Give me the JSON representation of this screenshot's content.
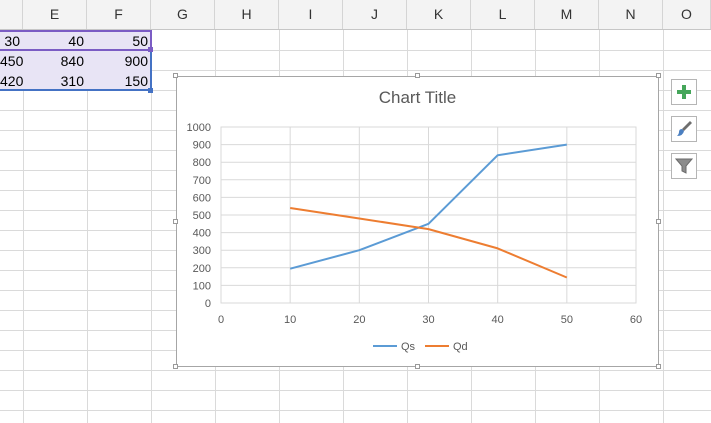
{
  "columns": [
    "E",
    "F",
    "G",
    "H",
    "I",
    "J",
    "K",
    "L",
    "M",
    "N",
    "O"
  ],
  "rows": [
    [
      "30",
      "40",
      "50"
    ],
    [
      "450",
      "840",
      "900"
    ],
    [
      "420",
      "310",
      "150"
    ]
  ],
  "colors": {
    "qs": "#5b9bd5",
    "qd": "#ed7d31",
    "selection_fill": "#e8e4f5",
    "selection_border_top": "#7b5cc4",
    "selection_border_rest": "#4472c4",
    "add_icon": "#45a65a"
  },
  "side_buttons": [
    "plus-icon",
    "paintbrush-icon",
    "filter-icon"
  ],
  "chart_data": {
    "type": "line",
    "title": "Chart Title",
    "xlim": [
      0,
      60
    ],
    "ylim": [
      0,
      1000
    ],
    "x_ticks": [
      0,
      10,
      20,
      30,
      40,
      50,
      60
    ],
    "y_ticks": [
      0,
      100,
      200,
      300,
      400,
      500,
      600,
      700,
      800,
      900,
      1000
    ],
    "grid": true,
    "legend_position": "bottom",
    "series": [
      {
        "name": "Qs",
        "x": [
          10,
          20,
          30,
          40,
          50
        ],
        "y": [
          195,
          300,
          450,
          840,
          900
        ]
      },
      {
        "name": "Qd",
        "x": [
          10,
          20,
          30,
          40,
          50
        ],
        "y": [
          540,
          480,
          420,
          310,
          145
        ]
      }
    ]
  }
}
